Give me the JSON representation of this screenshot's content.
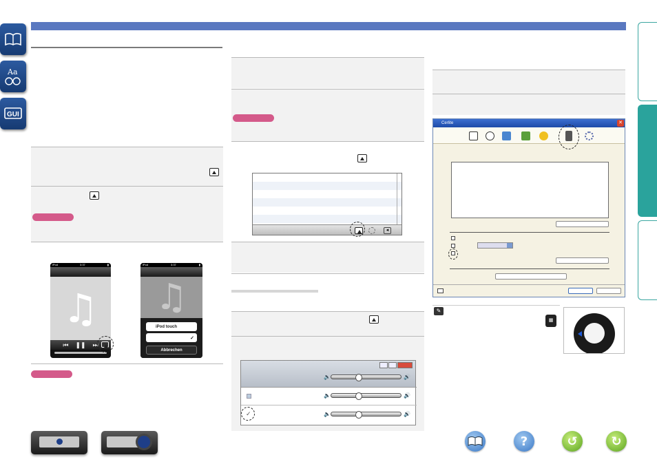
{
  "phone_a": {
    "status_left": "iPod",
    "status_time": "3:37"
  },
  "phone_b": {
    "status_left": "iPod",
    "status_time": "3:37",
    "option1": "iPod touch",
    "cancel": "Abbrechen"
  },
  "cerlite": {
    "title": "Cerlite",
    "close_glyph": "✕"
  },
  "colors": {
    "header_band": "#5a78c0",
    "note_pill": "#d45a8a",
    "side_tab_active": "#2aa39c",
    "side_icon": "#1f4c8f"
  },
  "icons": [
    "manual-book-icon",
    "glossary-icon",
    "gui-icon",
    "airplay-icon",
    "music-note-icon",
    "speaker-icon",
    "checkmark-icon",
    "pencil-note-icon",
    "remote-icon",
    "contents-icon",
    "help-icon",
    "back-icon",
    "forward-icon"
  ]
}
